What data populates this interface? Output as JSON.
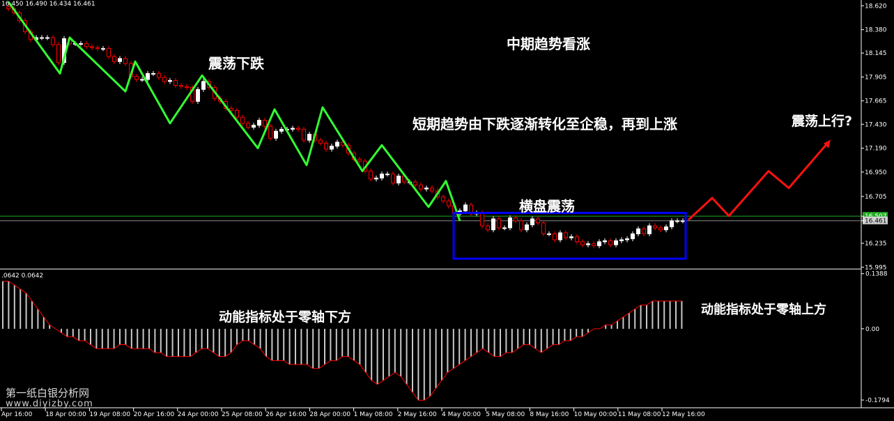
{
  "ohlc_header": "16.450 16.490 16.434 16.461",
  "indicator_header": ".0642 0.0642",
  "watermark": {
    "line1": "第一纸白银分析网",
    "line2": "www.diyizby.com"
  },
  "annotations": {
    "mid_trend": "中期趋势看涨",
    "down_osc": "震荡下跌",
    "short_trend": "短期趋势由下跌逐渐转化至企稳，再到上涨",
    "up_osc": "震荡上行?",
    "sideways": "横盘震荡",
    "momentum_below": "动能指标处于零轴下方",
    "momentum_above": "动能指标处于零轴上方"
  },
  "colors": {
    "background": "#000000",
    "bull_candle": "#ffffff",
    "bear_candle": "#ff0000",
    "wave_down": "#33ff33",
    "wave_up": "#ff1111",
    "box": "#0000ff",
    "hist": "#c8c8c8",
    "hist_line": "#ff0000",
    "level_line": "#22aa22"
  },
  "chart_data": [
    {
      "type": "candlestick",
      "title": "",
      "y_ticks": [
        "18.620",
        "18.380",
        "18.145",
        "17.905",
        "17.665",
        "17.430",
        "17.190",
        "16.950",
        "16.705",
        "16.507",
        "16.461",
        "16.235",
        "15.995"
      ],
      "ylim": [
        15.99,
        18.65
      ],
      "x_ticks": [
        "Apr 16:00",
        "18 Apr 00:00",
        "19 Apr 08:00",
        "20 Apr 16:00",
        "24 Apr 00:00",
        "25 Apr 08:00",
        "26 Apr 16:00",
        "28 Apr 00:00",
        "1 May 08:00",
        "2 May 16:00",
        "4 May 00:00",
        "5 May 08:00",
        "8 May 16:00",
        "10 May 00:00",
        "11 May 08:00",
        "12 May 16:00"
      ],
      "last_price": 16.461,
      "horizontal_level": 16.507,
      "close_series_approx": [
        18.59,
        18.55,
        18.47,
        18.36,
        18.28,
        18.3,
        18.3,
        18.3,
        18.23,
        18.05,
        18.29,
        18.24,
        18.24,
        18.24,
        18.21,
        18.2,
        18.19,
        18.19,
        18.11,
        18.06,
        18.09,
        18.04,
        17.91,
        17.88,
        17.88,
        17.94,
        17.94,
        17.9,
        17.86,
        17.87,
        17.82,
        17.81,
        17.8,
        17.66,
        17.78,
        17.86,
        17.8,
        17.69,
        17.66,
        17.59,
        17.57,
        17.5,
        17.44,
        17.4,
        17.42,
        17.47,
        17.41,
        17.29,
        17.36,
        17.38,
        17.38,
        17.39,
        17.38,
        17.27,
        17.33,
        17.27,
        17.24,
        17.18,
        17.21,
        17.25,
        17.22,
        17.14,
        17.08,
        17.06,
        16.96,
        16.88,
        16.89,
        16.93,
        16.93,
        16.84,
        16.91,
        16.85,
        16.85,
        16.82,
        16.78,
        16.79,
        16.76,
        16.7,
        16.66,
        16.61,
        16.53,
        16.56,
        16.62,
        16.53,
        16.54,
        16.41,
        16.37,
        16.48,
        16.39,
        16.39,
        16.49,
        16.46,
        16.37,
        16.42,
        16.48,
        16.44,
        16.33,
        16.33,
        16.27,
        16.34,
        16.29,
        16.3,
        16.25,
        16.22,
        16.23,
        16.21,
        16.25,
        16.26,
        16.22,
        16.26,
        16.27,
        16.28,
        16.33,
        16.38,
        16.33,
        16.41,
        16.39,
        16.37,
        16.4,
        16.46,
        16.46,
        16.46
      ],
      "wave_down_points": [
        18.66,
        17.94,
        18.3,
        17.76,
        18.06,
        17.44,
        17.92,
        17.19,
        17.58,
        17.02,
        17.6,
        16.96,
        17.22,
        16.6,
        16.86,
        16.46,
        16.66,
        16.3
      ],
      "wave_up_points": [
        16.47,
        16.69,
        16.51,
        16.96,
        16.79,
        17.26
      ],
      "sideways_box": {
        "low": 16.08,
        "high": 16.54
      }
    },
    {
      "type": "histogram",
      "series_name": "",
      "y_ticks": [
        "0.1388",
        "0.00",
        "-0.1794"
      ],
      "ylim": [
        -0.19,
        0.14
      ],
      "values": [
        0.12,
        0.12,
        0.11,
        0.1,
        0.09,
        0.07,
        0.05,
        0.03,
        0.01,
        -0.0,
        -0.01,
        -0.02,
        -0.02,
        -0.03,
        -0.03,
        -0.04,
        -0.05,
        -0.05,
        -0.05,
        -0.05,
        -0.04,
        -0.04,
        -0.05,
        -0.05,
        -0.05,
        -0.05,
        -0.06,
        -0.06,
        -0.07,
        -0.07,
        -0.07,
        -0.07,
        -0.07,
        -0.06,
        -0.05,
        -0.05,
        -0.06,
        -0.07,
        -0.07,
        -0.06,
        -0.04,
        -0.03,
        -0.03,
        -0.04,
        -0.05,
        -0.07,
        -0.08,
        -0.08,
        -0.08,
        -0.09,
        -0.09,
        -0.09,
        -0.09,
        -0.1,
        -0.1,
        -0.09,
        -0.08,
        -0.08,
        -0.07,
        -0.07,
        -0.08,
        -0.09,
        -0.11,
        -0.13,
        -0.14,
        -0.13,
        -0.12,
        -0.11,
        -0.12,
        -0.14,
        -0.16,
        -0.18,
        -0.18,
        -0.17,
        -0.15,
        -0.13,
        -0.11,
        -0.1,
        -0.09,
        -0.08,
        -0.07,
        -0.06,
        -0.05,
        -0.06,
        -0.07,
        -0.07,
        -0.06,
        -0.06,
        -0.05,
        -0.04,
        -0.04,
        -0.05,
        -0.06,
        -0.05,
        -0.04,
        -0.04,
        -0.03,
        -0.03,
        -0.02,
        -0.02,
        -0.01,
        -0.0,
        0.0,
        0.01,
        0.01,
        0.02,
        0.03,
        0.04,
        0.05,
        0.06,
        0.06,
        0.07,
        0.07,
        0.07,
        0.07,
        0.07,
        0.07
      ]
    }
  ]
}
